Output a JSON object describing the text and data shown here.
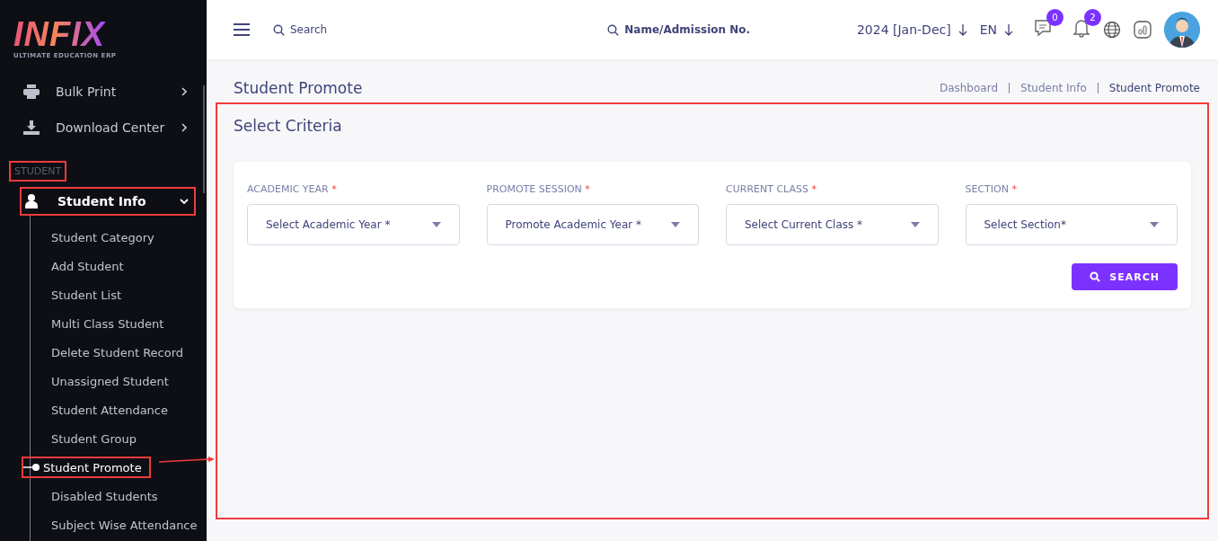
{
  "sidebar": {
    "logo": {
      "title": "INFIX",
      "subtitle": "ULTIMATE EDUCATION ERP"
    },
    "menu": [
      {
        "label": "Bulk Print",
        "kind": "print"
      },
      {
        "label": "Download Center",
        "kind": "download"
      }
    ],
    "section": {
      "label": "STUDENT",
      "highlighted": true
    },
    "group": {
      "label": "Student Info",
      "expanded": true,
      "highlighted": true,
      "items": [
        {
          "label": "Student Category",
          "selected": false
        },
        {
          "label": "Add Student",
          "selected": false
        },
        {
          "label": "Student List",
          "selected": false
        },
        {
          "label": "Multi Class Student",
          "selected": false
        },
        {
          "label": "Delete Student Record",
          "selected": false
        },
        {
          "label": "Unassigned Student",
          "selected": false
        },
        {
          "label": "Student Attendance",
          "selected": false
        },
        {
          "label": "Student Group",
          "selected": false
        },
        {
          "label": "Student Promote",
          "selected": true
        },
        {
          "label": "Disabled Students",
          "selected": false
        },
        {
          "label": "Subject Wise Attendance",
          "selected": false
        }
      ]
    }
  },
  "header": {
    "search": {
      "placeholder": "Search"
    },
    "student_search": {
      "placeholder": "Name/Admission No."
    },
    "year": "2024 [Jan-Dec]",
    "language": "EN",
    "messages_count": "0",
    "notifications_count": "2"
  },
  "page": {
    "title": "Student Promote",
    "breadcrumb": [
      "Dashboard",
      "Student Info",
      "Student Promote"
    ]
  },
  "criteria": {
    "title": "Select Criteria",
    "highlighted": true,
    "fields": [
      {
        "label": "ACADEMIC YEAR",
        "placeholder": "Select Academic Year *"
      },
      {
        "label": "PROMOTE SESSION",
        "placeholder": "Promote Academic Year *"
      },
      {
        "label": "CURRENT CLASS",
        "placeholder": "Select Current Class *"
      },
      {
        "label": "SECTION",
        "placeholder": "Select Section*"
      }
    ],
    "required_mark": "*",
    "button": "SEARCH"
  }
}
